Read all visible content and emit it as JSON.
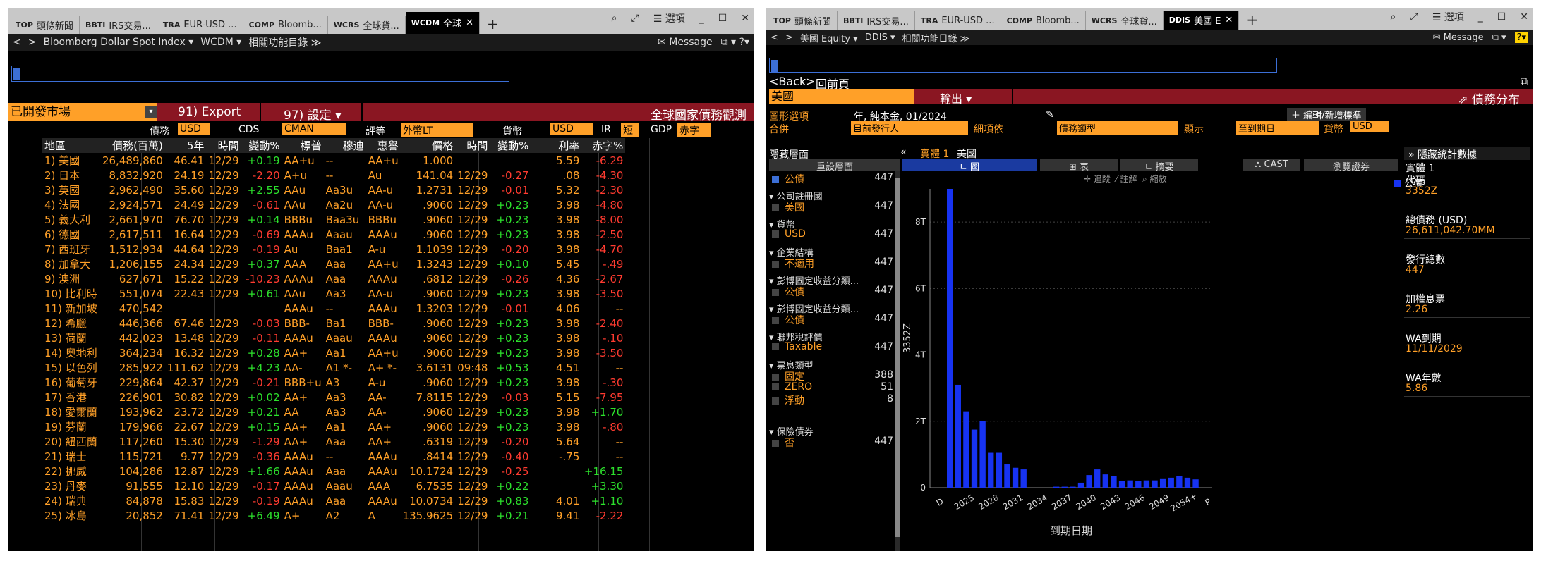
{
  "left": {
    "tabs": [
      {
        "code": "TOP",
        "title": "頭條新聞"
      },
      {
        "code": "BBTI",
        "title": "IRS交易..."
      },
      {
        "code": "TRA",
        "title": "EUR-USD ..."
      },
      {
        "code": "COMP",
        "title": "Bloomb..."
      },
      {
        "code": "WCRS",
        "title": "全球貨..."
      },
      {
        "code": "WCDM",
        "title": "全球"
      }
    ],
    "plus": "+",
    "search": "⌕",
    "expand": "⤢",
    "options": "☰ 選項",
    "minimize": "_",
    "maximize": "☐",
    "close": "✕",
    "nav": {
      "back": "<",
      "fwd": ">",
      "security": "Bloomberg Dollar Spot Index ▾",
      "func": "WCDM ▾",
      "related": "相關功能目錄 ≫",
      "message": "✉ Message",
      "mb": "⧉ ▾ ?▾"
    },
    "toolbar": {
      "market": "已開發市場",
      "export": "91) Export",
      "settings": "97) 設定 ▾",
      "title": "全球國家債務觀測"
    },
    "filters": {
      "debt_label": "債務",
      "debt_cur": "USD",
      "cds_label": "CDS",
      "cds_val": "CMAN",
      "rating_label": "評等",
      "rating_val": "外幣LT",
      "curr_label": "貨幣",
      "curr_val": "USD",
      "ir_label": "IR",
      "ir_val": "短",
      "gdp_label": "GDP",
      "gdp_val": "赤字"
    },
    "headers": [
      "地區",
      "債務(百萬)",
      "5年",
      "時間",
      "變動%",
      "標普",
      "穆迪",
      "惠譽",
      "價格",
      "時間",
      "變動%",
      "利率",
      "赤字%"
    ],
    "rows": [
      [
        "1) 美國",
        "26,489,860",
        "46.41",
        "12/29",
        "+0.19",
        "AA+u",
        "--",
        "AA+u",
        "1.000",
        "",
        "",
        "5.59",
        "-6.29"
      ],
      [
        "2) 日本",
        "8,832,920",
        "24.19",
        "12/29",
        "-2.20",
        "A+u",
        "--",
        "Au",
        "141.04",
        "12/29",
        "-0.27",
        ".08",
        "-4.30"
      ],
      [
        "3) 英國",
        "2,962,490",
        "35.60",
        "12/29",
        "+2.55",
        "AAu",
        "Aa3u",
        "AA-u",
        "1.2731",
        "12/29",
        "-0.01",
        "5.32",
        "-2.30"
      ],
      [
        "4) 法國",
        "2,924,571",
        "24.49",
        "12/29",
        "-0.61",
        "AAu",
        "Aa2u",
        "AA-u",
        ".9060",
        "12/29",
        "+0.23",
        "3.98",
        "-4.80"
      ],
      [
        "5) 義大利",
        "2,661,970",
        "76.70",
        "12/29",
        "+0.14",
        "BBBu",
        "Baa3u",
        "BBBu",
        ".9060",
        "12/29",
        "+0.23",
        "3.98",
        "-8.00"
      ],
      [
        "6) 德國",
        "2,617,511",
        "16.64",
        "12/29",
        "-0.69",
        "AAAu",
        "Aaau",
        "AAAu",
        ".9060",
        "12/29",
        "+0.23",
        "3.98",
        "-2.50"
      ],
      [
        "7) 西班牙",
        "1,512,934",
        "44.64",
        "12/29",
        "-0.19",
        "Au",
        "Baa1",
        "A-u",
        "1.1039",
        "12/29",
        "-0.20",
        "3.98",
        "-4.70"
      ],
      [
        "8) 加拿大",
        "1,206,155",
        "24.34",
        "12/29",
        "+0.37",
        "AAA",
        "Aaa",
        "AA+u",
        "1.3243",
        "12/29",
        "+0.10",
        "5.45",
        "-.49"
      ],
      [
        "9) 澳洲",
        "627,671",
        "15.22",
        "12/29",
        "-10.23",
        "AAAu",
        "Aaa",
        "AAAu",
        ".6812",
        "12/29",
        "-0.26",
        "4.36",
        "-2.67"
      ],
      [
        "10) 比利時",
        "551,074",
        "22.43",
        "12/29",
        "+0.61",
        "AAu",
        "Aa3",
        "AA-u",
        ".9060",
        "12/29",
        "+0.23",
        "3.98",
        "-3.50"
      ],
      [
        "11) 新加坡",
        "470,542",
        "",
        "",
        "",
        "AAAu",
        "--",
        "AAAu",
        "1.3203",
        "12/29",
        "-0.01",
        "4.06",
        "--"
      ],
      [
        "12) 希臘",
        "446,366",
        "67.46",
        "12/29",
        "-0.03",
        "BBB-",
        "Ba1",
        "BBB-",
        ".9060",
        "12/29",
        "+0.23",
        "3.98",
        "-2.40"
      ],
      [
        "13) 荷蘭",
        "442,023",
        "13.48",
        "12/29",
        "-0.11",
        "AAAu",
        "Aaau",
        "AAAu",
        ".9060",
        "12/29",
        "+0.23",
        "3.98",
        "-.10"
      ],
      [
        "14) 奧地利",
        "364,234",
        "16.32",
        "12/29",
        "+0.28",
        "AA+",
        "Aa1",
        "AA+u",
        ".9060",
        "12/29",
        "+0.23",
        "3.98",
        "-3.50"
      ],
      [
        "15) 以色列",
        "285,922",
        "111.62",
        "12/29",
        "+4.23",
        "AA-",
        "A1 *-",
        "A+ *-",
        "3.6131",
        "09:48",
        "+0.53",
        "4.51",
        "--"
      ],
      [
        "16) 葡萄牙",
        "229,864",
        "42.37",
        "12/29",
        "-0.21",
        "BBB+u",
        "A3",
        "A-u",
        ".9060",
        "12/29",
        "+0.23",
        "3.98",
        "-.30"
      ],
      [
        "17) 香港",
        "226,901",
        "30.82",
        "12/29",
        "+0.02",
        "AA+",
        "Aa3",
        "AA-",
        "7.8115",
        "12/29",
        "-0.03",
        "5.15",
        "-7.95"
      ],
      [
        "18) 愛爾蘭",
        "193,962",
        "23.72",
        "12/29",
        "+0.21",
        "AA",
        "Aa3",
        "AA-",
        ".9060",
        "12/29",
        "+0.23",
        "3.98",
        "+1.70"
      ],
      [
        "19) 芬蘭",
        "179,966",
        "22.67",
        "12/29",
        "+0.15",
        "AA+",
        "Aa1",
        "AA+",
        ".9060",
        "12/29",
        "+0.23",
        "3.98",
        "-.80"
      ],
      [
        "20) 紐西蘭",
        "117,260",
        "15.30",
        "12/29",
        "-1.29",
        "AA+",
        "Aaa",
        "AA+",
        ".6319",
        "12/29",
        "-0.20",
        "5.64",
        "--"
      ],
      [
        "21) 瑞士",
        "115,721",
        "9.77",
        "12/29",
        "-0.36",
        "AAAu",
        "--",
        "AAAu",
        ".8414",
        "12/29",
        "-0.40",
        "-.75",
        "--"
      ],
      [
        "22) 挪威",
        "104,286",
        "12.87",
        "12/29",
        "+1.66",
        "AAAu",
        "Aaa",
        "AAAu",
        "10.1724",
        "12/29",
        "-0.25",
        "",
        "+16.15"
      ],
      [
        "23) 丹麥",
        "91,555",
        "12.10",
        "12/29",
        "-0.17",
        "AAAu",
        "Aaau",
        "AAA",
        "6.7535",
        "12/29",
        "+0.22",
        "",
        "+3.30"
      ],
      [
        "24) 瑞典",
        "84,878",
        "15.83",
        "12/29",
        "-0.19",
        "AAAu",
        "Aaa",
        "AAAu",
        "10.0734",
        "12/29",
        "+0.83",
        "4.01",
        "+1.10"
      ],
      [
        "25) 冰島",
        "20,852",
        "71.41",
        "12/29",
        "+6.49",
        "A+",
        "A2",
        "A",
        "135.9625",
        "12/29",
        "+0.21",
        "9.41",
        "-2.22"
      ]
    ]
  },
  "right": {
    "tabs": [
      {
        "code": "TOP",
        "title": "頭條新聞"
      },
      {
        "code": "BBTI",
        "title": "IRS交易..."
      },
      {
        "code": "TRA",
        "title": "EUR-USD ..."
      },
      {
        "code": "COMP",
        "title": "Bloomb..."
      },
      {
        "code": "WCRS",
        "title": "全球貨..."
      },
      {
        "code": "DDIS",
        "title": "美國 E"
      }
    ],
    "nav": {
      "back": "<",
      "fwd": ">",
      "security": "美國 Equity ▾",
      "func": "DDIS ▾",
      "related": "相關功能目錄 ≫",
      "message": "✉ Message",
      "mb": "⧉ ▾",
      "help": "?▾"
    },
    "back_link": "<Back>",
    "back_text": "回前頁",
    "region": "美國",
    "export": "輸出 ▾",
    "dist_title": "債務分布",
    "opts": {
      "graph_label": "圖形選項",
      "graph_val": "年, 純本金, 01/2024",
      "merge_label": "合併",
      "merge_val": "目前發行人",
      "detail_label": "細項依",
      "detail_val": "債務類型",
      "show_label": "顯示",
      "show_val": "至到期日",
      "cur_label": "貨幣",
      "cur_val": "USD",
      "edit_btn": "＋ 編輯/新增標準"
    },
    "hidelayer": "隱藏層面",
    "collapse": "«",
    "reset": "重設層面",
    "entity_tab": "實體 1",
    "entity_name": "美國",
    "views": {
      "chart": "圖",
      "table": "表",
      "summary": "摘要",
      "cast": "CAST",
      "browse": "瀏覽證券"
    },
    "zoom": {
      "track": "追蹤",
      "annotate": "註解",
      "zoom": "縮放"
    },
    "legend": "公債",
    "filters": [
      {
        "title": "債券類型",
        "items": [
          {
            "name": "公債",
            "count": "447",
            "checked": true
          }
        ]
      },
      {
        "title": "公司註冊國",
        "items": [
          {
            "name": "美國",
            "count": "447"
          }
        ]
      },
      {
        "title": "貨幣",
        "items": [
          {
            "name": "USD",
            "count": "447"
          }
        ]
      },
      {
        "title": "企業結構",
        "items": [
          {
            "name": "不適用",
            "count": "447"
          }
        ]
      },
      {
        "title": "彭博固定收益分類...",
        "items": [
          {
            "name": "公債",
            "count": "447"
          }
        ]
      },
      {
        "title": "彭博固定收益分類...",
        "items": [
          {
            "name": "公債",
            "count": "447"
          }
        ]
      },
      {
        "title": "聯邦稅評價",
        "items": [
          {
            "name": "Taxable",
            "count": "447"
          }
        ]
      },
      {
        "title": "票息類型",
        "items": [
          {
            "name": "固定",
            "count": "388"
          },
          {
            "name": "ZERO",
            "count": "51"
          },
          {
            "name": "浮動",
            "count": "8"
          }
        ]
      },
      {
        "title": "保險債券",
        "items": [
          {
            "name": "否",
            "count": "447"
          }
        ]
      }
    ],
    "stats_title": "隱藏統計數據",
    "stats_entity": "實體 1",
    "stats": [
      {
        "label": "代碼",
        "value": "3352Z"
      },
      {
        "label": "總債務 (USD)",
        "value": "26,611,042.70MM"
      },
      {
        "label": "發行總數",
        "value": "447"
      },
      {
        "label": "加權息票",
        "value": "2.26"
      },
      {
        "label": "WA到期",
        "value": "11/11/2029"
      },
      {
        "label": "WA年數",
        "value": "5.86"
      }
    ]
  },
  "chart_data": {
    "type": "bar",
    "ylabel": "3352Z",
    "xlabel": "到期日期",
    "yticks": [
      "0",
      "2T",
      "4T",
      "6T",
      "8T"
    ],
    "xticks": [
      "D",
      "2025",
      "2028",
      "2031",
      "2034",
      "2037",
      "2040",
      "2043",
      "2046",
      "2049",
      "2054+",
      "P"
    ],
    "ylim": [
      0,
      9
    ],
    "values": [
      9.0,
      3.1,
      2.3,
      1.75,
      2.0,
      1.05,
      1.05,
      0.7,
      0.6,
      0.55,
      0,
      0,
      0,
      0.03,
      0.03,
      0.03,
      0.15,
      0.38,
      0.55,
      0.4,
      0.35,
      0.2,
      0.22,
      0.2,
      0.22,
      0.22,
      0.28,
      0.3,
      0.35,
      0.3,
      0.25
    ],
    "series": [
      {
        "name": "公債"
      }
    ]
  }
}
